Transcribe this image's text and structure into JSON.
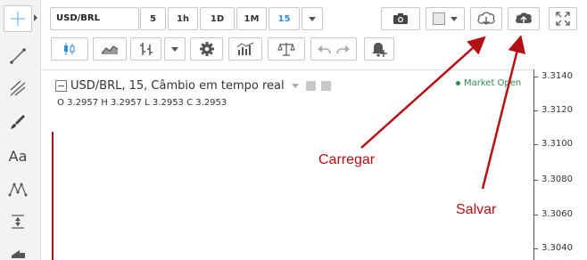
{
  "toolbar": {
    "symbol": "USD/BRL",
    "intervals": [
      "5",
      "1h",
      "1D",
      "1M",
      "15"
    ],
    "selected_interval": "15",
    "icons": [
      "camera-icon",
      "style-box-icon",
      "cloud-download-icon",
      "cloud-upload-icon",
      "fullscreen-icon"
    ]
  },
  "toolbar2": {
    "icons": [
      "candlestick-icon",
      "area-chart-icon",
      "bar-chart-icon",
      "gear-icon",
      "indicators-icon",
      "compare-scale-icon",
      "undo-icon",
      "redo-icon",
      "alert-add-icon"
    ]
  },
  "left_tools": [
    "crosshair-icon",
    "trendline-icon",
    "pitchfork-icon",
    "brush-icon",
    "text-tool-icon",
    "pattern-icon",
    "measure-icon",
    "arrow-tool-icon"
  ],
  "left_tools_text": {
    "text_tool": "Aa"
  },
  "legend": {
    "title": "USD/BRL, 15, Câmbio em tempo real",
    "ohlc": {
      "o_label": "O",
      "o": "3.2957",
      "h_label": "H",
      "h": "3.2957",
      "l_label": "L",
      "l": "3.2953",
      "c_label": "C",
      "c": "3.2953"
    },
    "market_status": "Market Open"
  },
  "price_scale": [
    "3.3140",
    "3.3120",
    "3.3100",
    "3.3080",
    "3.3060",
    "3.3040"
  ],
  "annotations": {
    "load": "Carregar",
    "save": "Salvar"
  },
  "colors": {
    "accent": "#2f8fd0",
    "annotation": "#b50f16",
    "bar": "#9b1b1b",
    "market_open": "#2e8b57"
  }
}
